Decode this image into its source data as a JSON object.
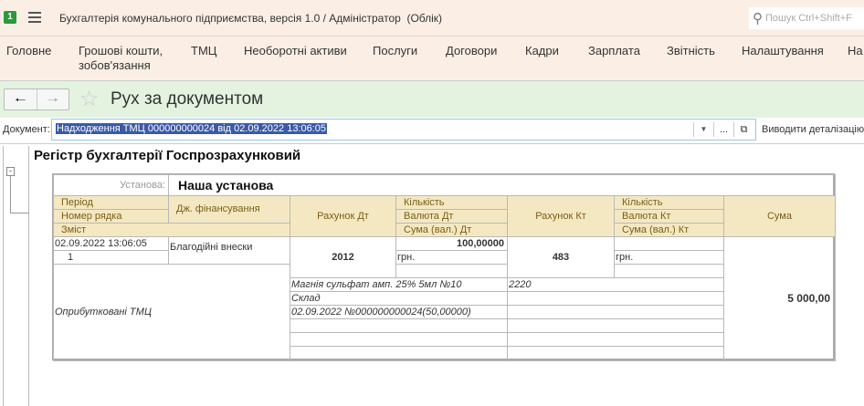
{
  "app": {
    "title": "Бухгалтерія комунального підприємства, версія 1.0 / Адміністратор  (Облік)",
    "search_placeholder": "Пошук Ctrl+Shift+F"
  },
  "menu": [
    "Головне",
    "Грошові кошти, зобов'язання",
    "ТМЦ",
    "Необоротні активи",
    "Послуги",
    "Договори",
    "Кадри",
    "Зарплата",
    "Звітність",
    "Налаштування",
    "На"
  ],
  "form": {
    "title": "Рух за документом",
    "document_label": "Документ:",
    "document_value": "Надходження ТМЦ 000000000024 від 02.09.2022 13:06:05",
    "detail_label": "Виводити деталізацію:"
  },
  "report": {
    "title": "Регістр бухгалтерії Госпрозрахунковий",
    "org_label": "Установа:",
    "org_value": "Наша установа",
    "headers": {
      "period": "Період",
      "line_no": "Номер рядка",
      "content": "Зміст",
      "fin_source": "Дж. фінансування",
      "acc_dt": "Рахунок Дт",
      "qty_dt": "Кількість",
      "cur_dt": "Валюта Дт",
      "sum_cur_dt": "Сума (вал.) Дт",
      "acc_kt": "Рахунок Кт",
      "qty_kt": "Кількість",
      "cur_kt": "Валюта Кт",
      "sum_cur_kt": "Сума (вал.) Кт",
      "sum": "Сума"
    },
    "row": {
      "period": "02.09.2022 13:06:05",
      "line_no": "1",
      "fin_source": "Благодійні внески",
      "content": "Оприбутковані ТМЦ",
      "acc_dt": "2012",
      "qty_dt": "100,00000",
      "cur_dt": "грн.",
      "acc_kt": "483",
      "cur_kt": "грн.",
      "sum": "5 000,00",
      "subconto_dt": [
        "Магнія сульфат амп. 25% 5мл №10",
        "Склад",
        "02.09.2022 №000000000024(50,00000)"
      ],
      "subconto_kt": [
        "2220"
      ]
    }
  }
}
